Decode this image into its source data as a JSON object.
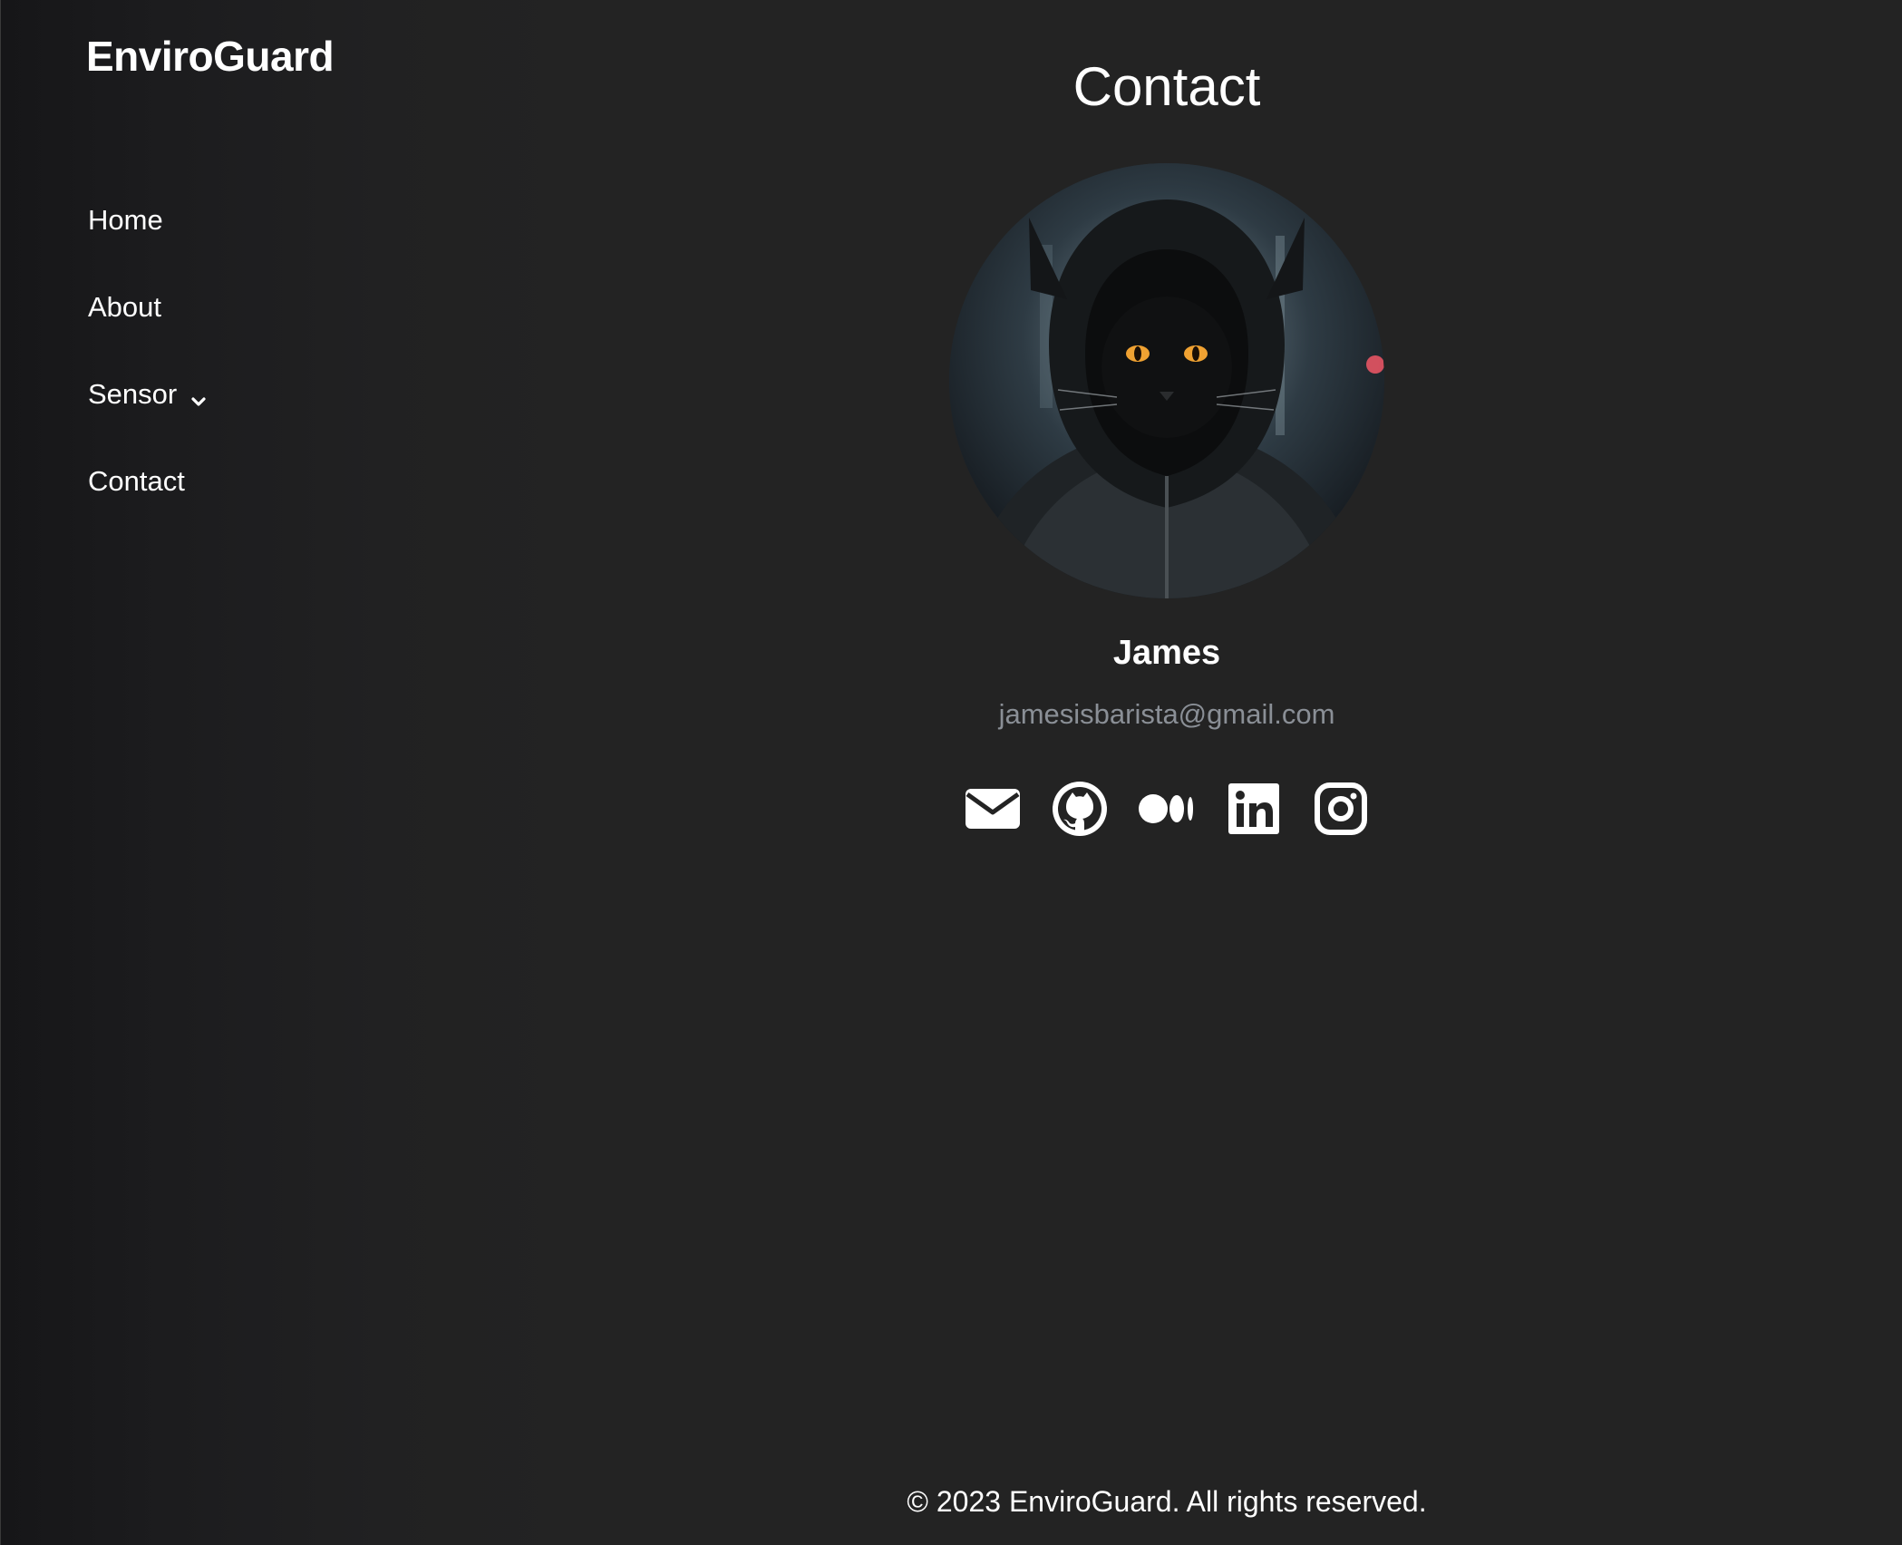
{
  "brand": "EnviroGuard",
  "sidebar": {
    "items": [
      {
        "label": "Home"
      },
      {
        "label": "About"
      },
      {
        "label": "Sensor",
        "icon": "chevron-down-icon"
      },
      {
        "label": "Contact"
      }
    ]
  },
  "main": {
    "title": "Contact",
    "profile": {
      "name": "James",
      "email": "jamesisbarista@gmail.com",
      "avatar": "hooded-black-cat-portrait"
    },
    "socials": [
      {
        "icon": "envelope-icon"
      },
      {
        "icon": "github-icon"
      },
      {
        "icon": "medium-icon"
      },
      {
        "icon": "linkedin-icon"
      },
      {
        "icon": "instagram-icon"
      }
    ]
  },
  "footer": {
    "text": "© 2023 EnviroGuard. All rights reserved."
  },
  "colors": {
    "background": "#232323",
    "text": "#ffffff",
    "muted": "#8a8f96"
  }
}
